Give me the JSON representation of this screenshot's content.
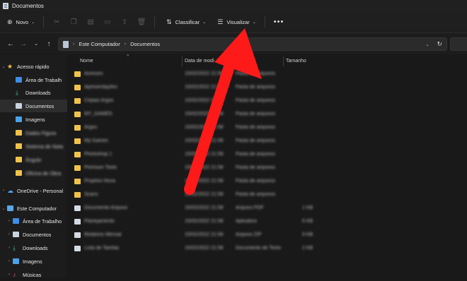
{
  "window": {
    "title": "Documentos"
  },
  "toolbar": {
    "new_label": "Novo",
    "sort_label": "Classificar",
    "view_label": "Visualizar",
    "more_label": "•••"
  },
  "address": {
    "crumb1": "Este Computador",
    "crumb2": "Documentos"
  },
  "sidebar": {
    "quick_access": "Acesso rápido",
    "qa_items": [
      "Área de Trabalh",
      "Downloads",
      "Documentos",
      "Imagens",
      "Dados Figura",
      "Sistema de Nota",
      "Ângulo",
      "Oficina de Obra"
    ],
    "onedrive": "OneDrive - Personal",
    "this_pc": "Este Computador",
    "pc_items": [
      "Área de Trabalho",
      "Documentos",
      "Downloads",
      "Imagens",
      "Músicas"
    ]
  },
  "columns": {
    "name": "Nome",
    "date": "Data de modi",
    "type": "Tipo",
    "size": "Tamanho"
  },
  "files": [
    {
      "name": "Acessos",
      "date": "15/02/2022 21:58",
      "type": "Pasta de arquivos",
      "size": ""
    },
    {
      "name": "Apresentações",
      "date": "15/02/2022 21:58",
      "type": "Pasta de arquivos",
      "size": ""
    },
    {
      "name": "Cópias Argos",
      "date": "15/02/2022 21:58",
      "type": "Pasta de arquivos",
      "size": ""
    },
    {
      "name": "MY_GAMES",
      "date": "15/02/2022 21:58",
      "type": "Pasta de arquivos",
      "size": ""
    },
    {
      "name": "Argos",
      "date": "15/02/2022 21:58",
      "type": "Pasta de arquivos",
      "size": ""
    },
    {
      "name": "My Games",
      "date": "15/02/2022 21:58",
      "type": "Pasta de arquivos",
      "size": ""
    },
    {
      "name": "Photoshop 1",
      "date": "15/02/2022 21:58",
      "type": "Pasta de arquivos",
      "size": ""
    },
    {
      "name": "Premium Tools",
      "date": "15/02/2022 21:58",
      "type": "Pasta de arquivos",
      "size": ""
    },
    {
      "name": "Projetos Nova",
      "date": "15/02/2022 21:58",
      "type": "Pasta de arquivos",
      "size": ""
    },
    {
      "name": "Scans",
      "date": "15/02/2022 21:58",
      "type": "Pasta de arquivos",
      "size": ""
    },
    {
      "name": "Documento Arquivo",
      "date": "15/02/2022 21:58",
      "type": "Arquivo PDF",
      "size": "1 KB"
    },
    {
      "name": "Planejamento",
      "date": "15/02/2022 21:58",
      "type": "Aplicativo",
      "size": "6 KB"
    },
    {
      "name": "Relatorio Mensal",
      "date": "15/02/2022 21:58",
      "type": "Arquivo ZIP",
      "size": "9 KB"
    },
    {
      "name": "Lista de Tarefas",
      "date": "15/02/2022 21:58",
      "type": "Documento de Texto",
      "size": "2 KB"
    }
  ],
  "colors": {
    "arrow": "#ff1a1a",
    "folder": "#f0c24b"
  }
}
